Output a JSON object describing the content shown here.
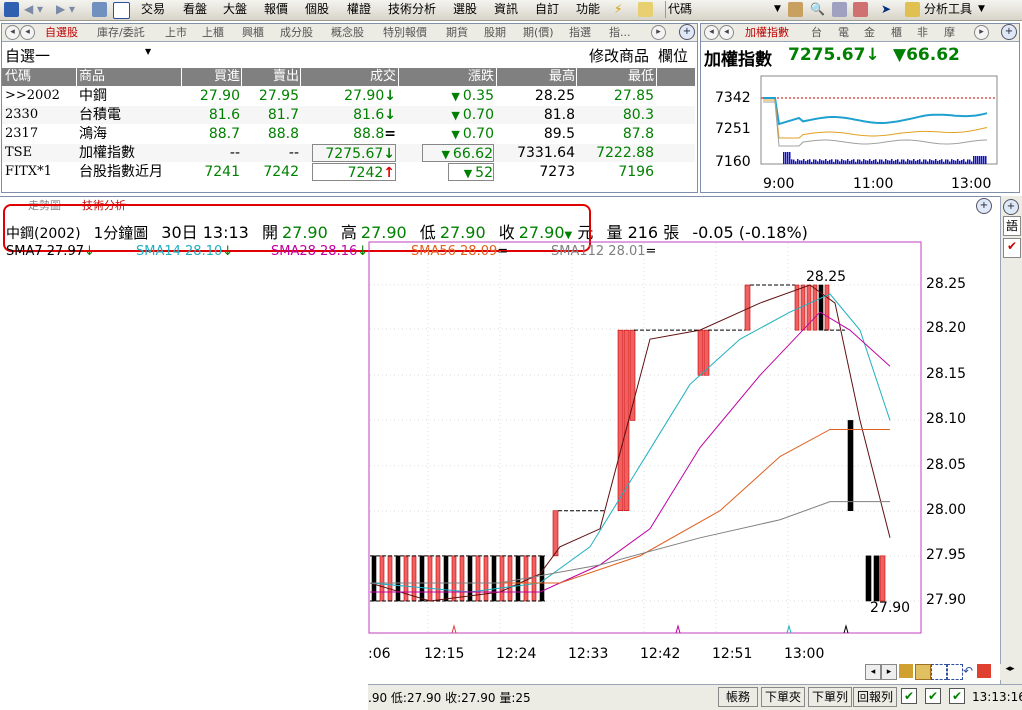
{
  "toolbar": {
    "items": [
      "交易",
      "看盤",
      "大盤",
      "報價",
      "個股",
      "權證",
      "技術分析",
      "選股",
      "資訊",
      "自訂",
      "功能",
      "代碼"
    ],
    "right_label": "分析工具"
  },
  "watchlist": {
    "tabs": [
      "自選股",
      "庫存/委託",
      "上市",
      "上櫃",
      "興櫃",
      "成分股",
      "概念股",
      "特別報價",
      "期貨",
      "股期",
      "期(價)",
      "指選",
      "指..."
    ],
    "group_name": "自選一",
    "edit_button": "修改商品",
    "fields_button": "欄位",
    "columns": [
      "代碼",
      "商品",
      "買進",
      "賣出",
      "成交",
      "漲跌",
      "最高",
      "最低"
    ],
    "rows": [
      {
        "code": ">>2002",
        "name": "中鋼",
        "bid": "27.90",
        "ask": "27.95",
        "last": "27.90",
        "last_arrow": "↓",
        "chg": "0.35",
        "chg_dir": "▼",
        "high": "28.25",
        "low": "27.85"
      },
      {
        "code": "2330",
        "name": "台積電",
        "bid": "81.6",
        "ask": "81.7",
        "last": "81.6",
        "last_arrow": "↓",
        "chg": "0.70",
        "chg_dir": "▼",
        "high": "81.8",
        "low": "80.3"
      },
      {
        "code": "2317",
        "name": "鴻海",
        "bid": "88.7",
        "ask": "88.8",
        "last": "88.8",
        "last_arrow": "=",
        "chg": "0.70",
        "chg_dir": "▼",
        "high": "89.5",
        "low": "87.8"
      },
      {
        "code": "TSE",
        "name": "加權指數",
        "bid": "--",
        "ask": "--",
        "last": "7275.67",
        "last_arrow": "↓",
        "chg": "66.62",
        "chg_dir": "▼",
        "high": "7331.64",
        "low": "7222.88"
      },
      {
        "code": "FITX*1",
        "name": "台股指數近月",
        "bid": "7241",
        "ask": "7242",
        "last": "7242",
        "last_arrow": "↑",
        "chg": "52",
        "chg_dir": "▼",
        "high": "7273",
        "low": "7196"
      }
    ]
  },
  "index_panel": {
    "tabs": [
      "加權指數",
      "台",
      "電",
      "金",
      "櫃",
      "非",
      "摩"
    ],
    "title": "加權指數",
    "value": "7275.67",
    "value_arrow": "↓",
    "change": "▼66.62",
    "y_ticks": [
      "7342",
      "7251",
      "7160"
    ],
    "x_ticks": [
      "9:00",
      "11:00",
      "13:00"
    ]
  },
  "chart_panel": {
    "tabs": [
      "走勢圖",
      "技術分析"
    ],
    "info": {
      "symbol": "中鋼(2002)",
      "interval": "1分鐘圖",
      "datetime": "30日 13:13",
      "open_label": "開",
      "open": "27.90",
      "high_label": "高",
      "high": "27.90",
      "low_label": "低",
      "low": "27.90",
      "close_label": "收",
      "close": "27.90",
      "close_arrow": "▼",
      "unit": "元",
      "vol_label": "量",
      "volume": "216",
      "vol_unit": "張",
      "change": "-0.05 (-0.18%)"
    },
    "sma": [
      {
        "label": "SMA7 27.97",
        "suffix": "↓",
        "color": "#000000"
      },
      {
        "label": "SMA14 28.10",
        "suffix": "↓",
        "color": "#20b0c0"
      },
      {
        "label": "SMA28 28.16",
        "suffix": "↓",
        "color": "#c000a0"
      },
      {
        "label": "SMA56 28.09",
        "suffix": "=",
        "color": "#e06020"
      },
      {
        "label": "SMA112 28.01",
        "suffix": "=",
        "color": "#808080"
      }
    ],
    "y_ticks": [
      "28.25",
      "28.20",
      "28.15",
      "28.10",
      "28.05",
      "28.00",
      "27.95",
      "27.90"
    ],
    "x_ticks": [
      ":06",
      "12:15",
      "12:24",
      "12:33",
      "12:42",
      "12:51",
      "13:00"
    ],
    "peak_label": "28.25",
    "last_label": "27.90",
    "status_text": ".90 低:27.90 收:27.90 量:25"
  },
  "statusbar": {
    "buttons": [
      "帳務",
      "下單夾",
      "下單列",
      "回報列"
    ],
    "time": "13:13:16"
  },
  "side_icons": [
    "語"
  ],
  "colors": {
    "highlight": "#e00000",
    "up": "#e00000",
    "down": "#008000",
    "header_bg": "#808080",
    "chart_frame": "#c040c0"
  }
}
